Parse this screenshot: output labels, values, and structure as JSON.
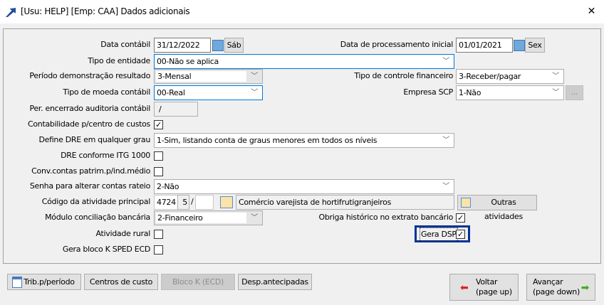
{
  "window": {
    "title": "[Usu: HELP] [Emp: CAA] Dados adicionais",
    "close": "✕"
  },
  "form": {
    "data_contabil": {
      "label": "Data contábil",
      "value": "31/12/2022",
      "day": "Sáb"
    },
    "data_proc": {
      "label": "Data de processamento inicial",
      "value": "01/01/2021",
      "day": "Sex"
    },
    "tipo_entidade": {
      "label": "Tipo de entidade",
      "value": "00-Não se aplica"
    },
    "periodo": {
      "label": "Período demonstração resultado",
      "value": "3-Mensal"
    },
    "tipo_controle": {
      "label": "Tipo de controle financeiro",
      "value": "3-Receber/pagar"
    },
    "tipo_moeda": {
      "label": "Tipo de moeda contábil",
      "value": "00-Real"
    },
    "empresa_scp": {
      "label": "Empresa SCP",
      "value": "1-Não",
      "button": "..."
    },
    "per_encerrado": {
      "label": "Per. encerrado auditoria contábil",
      "value": "/"
    },
    "contab_centro": {
      "label": "Contabilidade p/centro de custos",
      "checked": true
    },
    "define_dre": {
      "label": "Define DRE em qualquer grau",
      "value": "1-Sim, listando conta de graus menores em todos os níveis"
    },
    "dre_itg": {
      "label": "DRE conforme ITG 1000",
      "checked": false
    },
    "conv_contas": {
      "label": "Conv.contas patrim.p/ind.médio",
      "checked": false
    },
    "senha_rateio": {
      "label": "Senha para alterar contas rateio",
      "value": "2-Não"
    },
    "codigo_atividade": {
      "label": "Código da atividade principal",
      "code": "4724",
      "sub": "5",
      "sep": "/",
      "extra": "",
      "description": "Comércio varejista de hortifrutigranjeiros",
      "other_button": "Outras atividades"
    },
    "modulo_conc": {
      "label": "Módulo conciliação bancária",
      "value": "2-Financeiro"
    },
    "obriga_hist": {
      "label": "Obriga histórico no extrato bancário",
      "checked": true
    },
    "atividade_rural": {
      "label": "Atividade rural",
      "checked": false
    },
    "gera_dsp": {
      "label": "Gera DSP",
      "checked": true
    },
    "gera_bloco_k": {
      "label": "Gera bloco K SPED ECD",
      "checked": false
    }
  },
  "buttons": {
    "trib": "Trib.p/período",
    "centros": "Centros de custo",
    "bloco_k": "Bloco K (ECD)",
    "desp": "Desp.antecipadas",
    "voltar": "Voltar",
    "voltar_sub": "(page up)",
    "avancar": "Avançar",
    "avancar_sub": "(page down)"
  },
  "colors": {
    "focus": "#0078d7",
    "highlight": "#003399"
  }
}
